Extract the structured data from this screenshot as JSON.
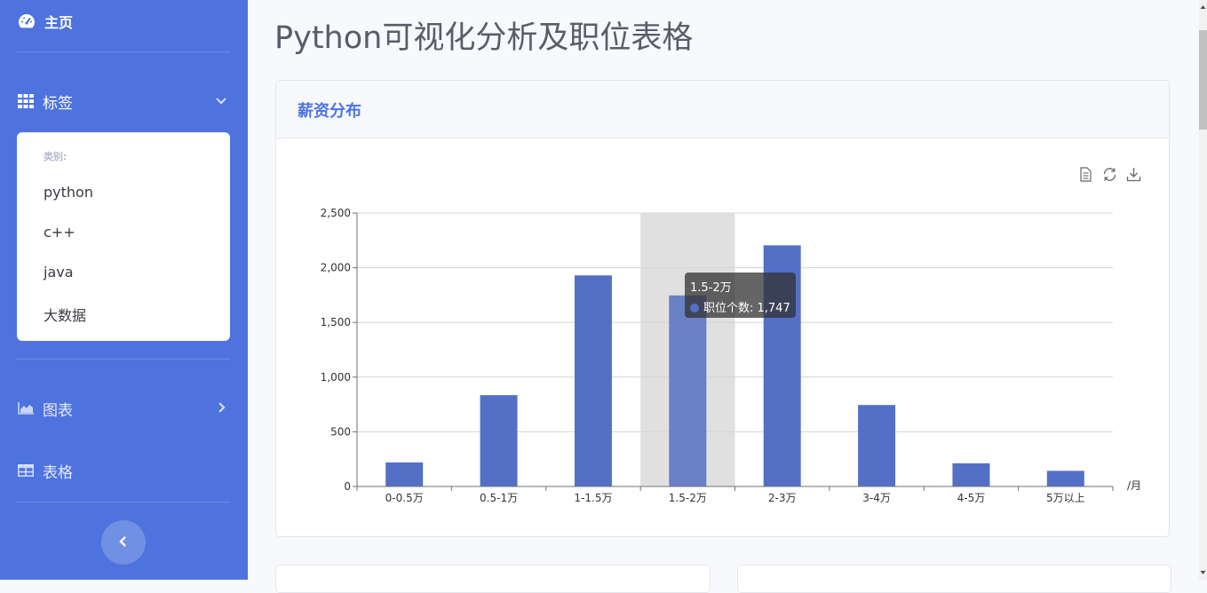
{
  "sidebar": {
    "home_label": "主页",
    "tags_label": "标签",
    "dropdown": {
      "header": "类别:",
      "items": [
        "python",
        "c++",
        "java",
        "大数据"
      ]
    },
    "charts_label": "图表",
    "tables_label": "表格"
  },
  "page": {
    "title": "Python可视化分析及职位表格"
  },
  "card": {
    "title": "薪资分布"
  },
  "chart_data": {
    "type": "bar",
    "categories": [
      "0-0.5万",
      "0.5-1万",
      "1-1.5万",
      "1.5-2万",
      "2-3万",
      "3-4万",
      "4-5万",
      "5万以上"
    ],
    "series": [
      {
        "name": "职位个数",
        "values": [
          220,
          835,
          1930,
          1747,
          2205,
          745,
          212,
          143
        ],
        "color": "#5470c6"
      }
    ],
    "xlabel": "/月",
    "ylabel": "",
    "ylim": [
      0,
      2500
    ],
    "yticks": [
      0,
      500,
      1000,
      1500,
      2000,
      2500
    ],
    "ytick_labels": [
      "0",
      "500",
      "1,000",
      "1,500",
      "2,000",
      "2,500"
    ],
    "grid": true,
    "highlighted_category": "1.5-2万",
    "tooltip": {
      "title": "1.5-2万",
      "label": "职位个数: 1,747"
    }
  },
  "toolbox": {
    "icons": [
      "data-view-icon",
      "restore-icon",
      "save-image-icon"
    ]
  },
  "colors": {
    "sidebar_bg": "#4e73df",
    "bar": "#5470c6",
    "bar_highlight": "#6a80c4",
    "title_accent": "#4e73df"
  }
}
